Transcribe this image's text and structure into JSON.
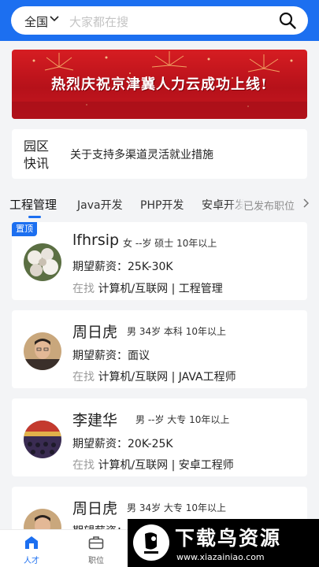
{
  "search": {
    "city": "全国",
    "placeholder": "大家都在搜"
  },
  "banner": {
    "text": "热烈庆祝京津冀人力云成功上线!",
    "slide_count": 3,
    "active_slide": 1
  },
  "news": {
    "tag_line1": "园区",
    "tag_line2": "快讯",
    "headline": "关于支持多渠道灵活就业措施"
  },
  "tabs": {
    "items": [
      "工程管理",
      "Java开发",
      "PHP开发",
      "安卓开发"
    ],
    "active_index": 0,
    "posted_label": "已发布职位"
  },
  "candidates": [
    {
      "pinned": true,
      "pin_label": "置顶",
      "name": "lfhrsip",
      "meta": "女 --岁 硕士 10年以上",
      "salary_label": "期望薪资：",
      "salary": "25K-30K",
      "seeking_prefix": "在找",
      "seeking": "计算机/互联网 | 工程管理",
      "avatar": "flowers"
    },
    {
      "pinned": false,
      "name": "周日虎",
      "meta": "男 34岁 本科 10年以上",
      "salary_label": "期望薪资：",
      "salary": "面议",
      "seeking_prefix": "在找",
      "seeking": "计算机/互联网 | JAVA工程师",
      "avatar": "man-portrait"
    },
    {
      "pinned": false,
      "name": "李建华",
      "meta": "男 --岁 大专 10年以上",
      "salary_label": "期望薪资：",
      "salary": "20K-25K",
      "seeking_prefix": "在找",
      "seeking": "计算机/互联网 | 安卓工程师",
      "avatar": "meeting-hall"
    },
    {
      "pinned": false,
      "name": "周日虎",
      "meta": "男 34岁 大专 10年以上",
      "salary_label": "期望薪资：",
      "salary": "",
      "seeking_prefix": "",
      "seeking": "",
      "avatar": "man-portrait"
    }
  ],
  "bottom_nav": {
    "items": [
      {
        "label": "人才",
        "icon": "home-icon",
        "active": true
      },
      {
        "label": "职位",
        "icon": "briefcase-icon",
        "active": false
      }
    ]
  },
  "watermark": {
    "title": "下载鸟资源",
    "url": "www.xiazainiao.com"
  },
  "colors": {
    "primary": "#1c6ff0",
    "background": "#f3f4f6",
    "banner_red": "#d61d22"
  }
}
